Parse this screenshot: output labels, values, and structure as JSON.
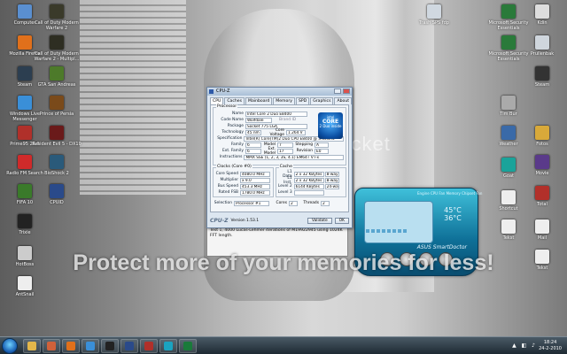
{
  "desktop": {
    "left_icons": [
      {
        "label": "Computer",
        "color": "#5a8fd0"
      },
      {
        "label": "Call of Duty Modern Warfare 2",
        "color": "#3a3a2a"
      },
      {
        "label": "Mozilla Firefox",
        "color": "#e0701b"
      },
      {
        "label": "Call of Duty Modern Warfare 2 - Multipl...",
        "color": "#2e2e22"
      },
      {
        "label": "Steam",
        "color": "#2c3e50"
      },
      {
        "label": "GTA San Andreas",
        "color": "#4d7a2a"
      },
      {
        "label": "Windows Live Messenger",
        "color": "#3a8fd8"
      },
      {
        "label": "Prince of Persia",
        "color": "#7a4a1a"
      },
      {
        "label": "Prime95 26.6",
        "color": "#b0302a"
      },
      {
        "label": "Resident Evil 5 - DX10",
        "color": "#6a1a1a"
      },
      {
        "label": "Radio FM Search",
        "color": "#d02a2a"
      },
      {
        "label": "BioShock 2",
        "color": "#2a5a7a"
      },
      {
        "label": "FIFA 10",
        "color": "#3a7a2a"
      },
      {
        "label": "CPUID",
        "color": "#2a4a8a"
      },
      {
        "label": "Trixie",
        "color": "#222222"
      },
      {
        "label": "HotBoss",
        "color": "#cccccc"
      },
      {
        "label": "AntSnail",
        "color": "#eeeeee"
      }
    ],
    "right_icons": [
      {
        "label": "Trash SPS fdp",
        "color": "#d0d8e0"
      },
      {
        "label": "Microsoft Security Essentials",
        "color": "#2a7a3a"
      },
      {
        "label": "Kdin",
        "color": "#dddddd"
      },
      {
        "label": "Prullenbak",
        "color": "#cfd6dd"
      },
      {
        "label": "Microsoft Security Essentials",
        "color": "#2a7a3a"
      },
      {
        "label": "Steam",
        "color": "#333333"
      },
      {
        "label": "Tim Bur",
        "color": "#aaaaaa"
      },
      {
        "label": "Fotos",
        "color": "#d8a93a"
      },
      {
        "label": "Weather",
        "color": "#3a6aa8"
      },
      {
        "label": "Movie",
        "color": "#5a3a8a"
      },
      {
        "label": "Goat",
        "color": "#1aa39a"
      },
      {
        "label": "Total",
        "color": "#b2302a"
      },
      {
        "label": "Shortcut",
        "color": "#eeeeee"
      },
      {
        "label": "Tekst",
        "color": "#eeeeee"
      },
      {
        "label": "Mail",
        "color": "#eeeeee"
      },
      {
        "label": "Tekst",
        "color": "#eeeeee"
      }
    ]
  },
  "watermark": "Protect more of your memories for less!",
  "pb_logo": "photobucket",
  "cpuz": {
    "title": "CPU-Z",
    "tabs": [
      "CPU",
      "Caches",
      "Mainboard",
      "Memory",
      "SPD",
      "Graphics",
      "About"
    ],
    "active_tab": "CPU",
    "processor": {
      "group": "Processor",
      "name_label": "Name",
      "name": "Intel Core 2 Duo E8400",
      "code_label": "Code Name",
      "code": "Wolfdale",
      "brand_id": "Brand ID",
      "package_label": "Package",
      "package": "Socket 775 LGA",
      "tech_label": "Technology",
      "tech": "45 nm",
      "cv_label": "Core Voltage",
      "cv": "1.264 V",
      "spec_label": "Specification",
      "spec": "Intel(R) Core(TM)2 Duo CPU  E8400 @ 3.00GHz",
      "family_label": "Family",
      "family": "6",
      "model_label": "Model",
      "model": "7",
      "stepping_label": "Stepping",
      "stepping": "A",
      "extfam_label": "Ext. Family",
      "extfam": "6",
      "extmod_label": "Ext. Model",
      "extmod": "17",
      "rev_label": "Revision",
      "rev": "E0",
      "instr_label": "Instructions",
      "instr": "MMX SSE (1, 2, 3, 3S, 4.1) EM64T VT-x"
    },
    "clocks": {
      "group": "Clocks (Core #0)",
      "speed_label": "Core Speed",
      "speed": "4080.0 MHz",
      "mult_label": "Multiplier",
      "mult": "x 9.0",
      "bus_label": "Bus Speed",
      "bus": "453.3 MHz",
      "fsb_label": "Rated FSB",
      "fsb": "1780.0 MHz"
    },
    "cache": {
      "group": "Cache",
      "l1d_label": "L1 Data",
      "l1d": "2 x 32 KBytes",
      "l1d_way": "8-way",
      "l1i_label": "L1 Inst.",
      "l1i": "2 x 32 KBytes",
      "l1i_way": "8-way",
      "l2_label": "Level 2",
      "l2": "6144 KBytes",
      "l2_way": "24-way",
      "l3_label": "Level 3",
      "l3": ""
    },
    "intel_logo": {
      "top": "intel",
      "mid": "CORE",
      "bot": "2 Duo inside"
    },
    "selection_label": "Selection",
    "selection": "Processor #1",
    "cores_label": "Cores",
    "cores": "2",
    "threads_label": "Threads",
    "threads": "2",
    "version": "Version 1.53.1",
    "logo": "CPU-Z",
    "validate": "Validate",
    "ok": "OK"
  },
  "console": {
    "lines": [
      "Press Stop to end this test.",
      "Test 1, 4000 Lucas-Lehmer iterations of M19922945 using 1024K FFT length."
    ]
  },
  "asus": {
    "header": "Engine   CPU Fan   Memory   Chipset   Fan",
    "temp_top": "45°C",
    "temp_bot": "36°C",
    "brand": "ASUS SmartDoctor"
  },
  "taskbar": {
    "time": "18:24",
    "date": "24-2-2010",
    "apps": [
      {
        "name": "explorer",
        "color": "#e2b64a"
      },
      {
        "name": "media",
        "color": "#d0613a"
      },
      {
        "name": "firefox",
        "color": "#e0701b"
      },
      {
        "name": "messenger",
        "color": "#3a8fd8"
      },
      {
        "name": "steam",
        "color": "#222222"
      },
      {
        "name": "cpuz",
        "color": "#2a4a8a"
      },
      {
        "name": "prime",
        "color": "#b0302a"
      },
      {
        "name": "asus",
        "color": "#1aa3c0"
      },
      {
        "name": "gta",
        "color": "#1a7a3a"
      }
    ]
  }
}
